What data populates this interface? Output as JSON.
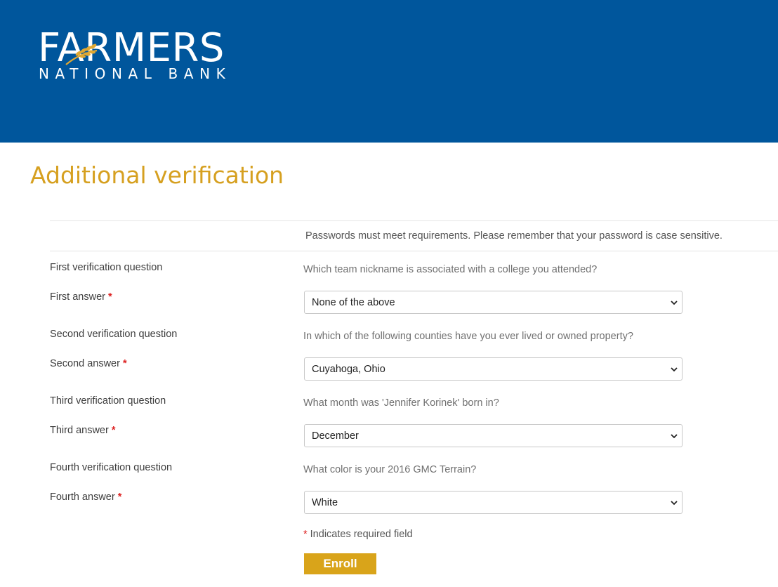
{
  "brand": {
    "name_top": "FARMERS",
    "name_bottom": "NATIONAL BANK",
    "header_color": "#00569c",
    "accent_color": "#d6a020"
  },
  "page": {
    "title": "Additional verification",
    "notice": "Passwords must meet requirements. Please remember that your password is case sensitive."
  },
  "form": {
    "rows": [
      {
        "question_label": "First verification question",
        "question": "Which team nickname is associated with a college you attended?",
        "answer_label": "First answer",
        "answer": "None of the above"
      },
      {
        "question_label": "Second verification question",
        "question": "In which of the following counties have you ever lived or owned property?",
        "answer_label": "Second answer",
        "answer": "Cuyahoga, Ohio"
      },
      {
        "question_label": "Third verification question",
        "question": "What month was 'Jennifer Korinek' born in?",
        "answer_label": "Third answer",
        "answer": "December"
      },
      {
        "question_label": "Fourth verification question",
        "question": "What color is your 2016 GMC Terrain?",
        "answer_label": "Fourth answer",
        "answer": "White"
      }
    ],
    "required_marker": "*",
    "required_note": "Indicates required field",
    "submit_label": "Enroll"
  }
}
